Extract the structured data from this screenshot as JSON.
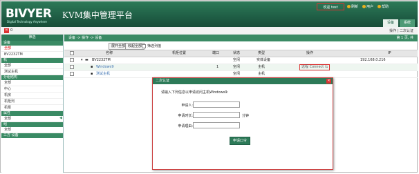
{
  "header": {
    "logo": "BIVYER",
    "logo_sub": "Digital Technology Anywhere",
    "title": "KVM集中管理平台",
    "welcome": "欢迎 test",
    "links": [
      "刷新",
      "用户",
      "帮助"
    ],
    "tabs": [
      "设备",
      "系统"
    ]
  },
  "subbar": {
    "close": "✕",
    "count": "0",
    "right": "操作 | 二次认证"
  },
  "sidebar": {
    "title": "筛选",
    "sections": [
      {
        "group": "设备",
        "items": [
          {
            "label": "全部",
            "red": true
          },
          {
            "label": "BV2232TM",
            "red": false
          }
        ]
      },
      {
        "group": "机",
        "items": [
          {
            "label": "全部",
            "red": false
          },
          {
            "label": "测试主机",
            "red": false
          }
        ]
      },
      {
        "group": "分组结构",
        "items": [
          {
            "label": "全部",
            "red": false
          },
          {
            "label": "中心",
            "red": false
          },
          {
            "label": "机房",
            "red": false
          },
          {
            "label": "机柜列",
            "red": false
          },
          {
            "label": "机柜",
            "red": false
          }
        ]
      },
      {
        "group": "属性",
        "items": [
          {
            "label": "全部",
            "red": false
          }
        ]
      },
      {
        "group": "组",
        "items": [
          {
            "label": "全部",
            "red": false
          }
        ]
      },
      {
        "group": "三方 设备",
        "items": []
      }
    ]
  },
  "main": {
    "breadcrumb": "设备 -> 操作 -> 设备",
    "page_info": "第 1 页, 共",
    "toolbar": {
      "expand": "展开全部",
      "collapse": "收起全部",
      "filter_label": "筛选列值"
    },
    "columns": [
      "名称",
      "机柜位置",
      "端口",
      "状态",
      "类型",
      "操作",
      "IP"
    ],
    "rows": [
      {
        "name": "BV2232TM",
        "position": "",
        "port": "",
        "status": "空闲",
        "type": "实体设备",
        "action": "",
        "ip": "192.168.0.216"
      },
      {
        "name": "Windows9",
        "position": "",
        "port": "1",
        "status": "空闲",
        "type": "主机",
        "action": "远程 Connect",
        "ip": ""
      },
      {
        "name": "测试主机",
        "position": "",
        "port": "",
        "status": "空闲",
        "type": "主机",
        "action": "",
        "ip": ""
      }
    ]
  },
  "dialog": {
    "title": "二次认证",
    "close": "✕",
    "prompt": "请输入下列信息以申请访问主机Windows9:",
    "applicant_label": "申请人:",
    "duration_label": "申请时长:",
    "duration_unit": "分钟",
    "reason_label": "申请理由:",
    "submit": "申请口令"
  }
}
